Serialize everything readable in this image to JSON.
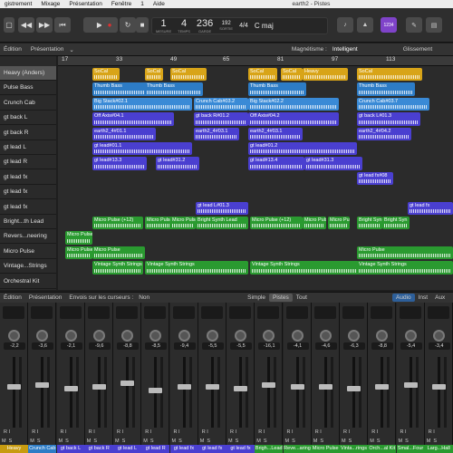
{
  "menubar": {
    "items": [
      "gistrement",
      "Mixage",
      "Présentation",
      "Fenêtre",
      "1",
      "Aide"
    ],
    "title": "earth2 - Pistes"
  },
  "transport": {
    "bar": "1",
    "beat": "4",
    "tempo": "236",
    "tempo_label": "TEMPO",
    "bar_label": "MESURE",
    "beat_label": "TEMPS",
    "keep_label": "GARDE",
    "cpu_value": "192",
    "cpu_label": "SORTIE",
    "signature": "4/4",
    "key": "C maj",
    "icon1": "tuner-icon",
    "icon2": "count-in-icon",
    "badge": "1234"
  },
  "toolbar": {
    "edit": "Édition",
    "presentation": "Présentation",
    "snap_label": "Magnétisme :",
    "snap_value": "Intelligent",
    "drag_label": "Glissement"
  },
  "ruler": {
    "ticks": [
      "17",
      "33",
      "49",
      "65",
      "81",
      "97",
      "113"
    ]
  },
  "tracks": [
    {
      "name": "Heavy (Anders)",
      "selected": true
    },
    {
      "name": "Pulse Bass"
    },
    {
      "name": "Crunch Cab"
    },
    {
      "name": "gt back L"
    },
    {
      "name": "gt back R"
    },
    {
      "name": "gt lead L"
    },
    {
      "name": "gt lead R"
    },
    {
      "name": "gt lead fx"
    },
    {
      "name": "gt lead fx"
    },
    {
      "name": "gt lead fx"
    },
    {
      "name": "Bright...th Lead"
    },
    {
      "name": "Revers...neering"
    },
    {
      "name": "Micro Pulse"
    },
    {
      "name": "Vintage...Strings"
    },
    {
      "name": "Orchestral Kit"
    }
  ],
  "regions": [
    {
      "label": "SoCal",
      "track": 0,
      "color": "#d8a418"
    },
    {
      "label": "SoCal",
      "track": 0,
      "color": "#d8a418"
    },
    {
      "label": "SoCal",
      "track": 0,
      "color": "#d8a418"
    },
    {
      "label": "SoCal",
      "track": 0,
      "color": "#d8a418"
    },
    {
      "label": "SoCal",
      "track": 0,
      "color": "#d8a418"
    },
    {
      "label": "Heavy",
      "track": 0,
      "color": "#d8a418"
    },
    {
      "label": "SoCal",
      "track": 0,
      "color": "#d8a418"
    },
    {
      "label": "Thumb Bass",
      "track": 1,
      "color": "#2d7cc6"
    },
    {
      "label": "Thumb Bass",
      "track": 1,
      "color": "#2d7cc6"
    },
    {
      "label": "Thumb Bass",
      "track": 1,
      "color": "#2d7cc6"
    },
    {
      "label": "Thumb Bass",
      "track": 1,
      "color": "#2d7cc6"
    },
    {
      "label": "Big Stack#02.1",
      "track": 2,
      "color": "#3a8ad6"
    },
    {
      "label": "Crunch Cab#03.2",
      "track": 2,
      "color": "#3a8ad6"
    },
    {
      "label": "Big Stack#02.2",
      "track": 2,
      "color": "#3a8ad6"
    },
    {
      "label": "Crunch Cab#03.7",
      "track": 2,
      "color": "#3a8ad6"
    },
    {
      "label": "Off Axis#04.1",
      "track": 3,
      "color": "#4a3fd0"
    },
    {
      "label": "gt back R#01.2",
      "track": 3,
      "color": "#4a3fd0"
    },
    {
      "label": "Off Axis#04.2",
      "track": 3,
      "color": "#4a3fd0"
    },
    {
      "label": "gt back L#01.3",
      "track": 3,
      "color": "#4a3fd0"
    },
    {
      "label": "earth2_4#01.1",
      "track": 4,
      "color": "#4a3fd0"
    },
    {
      "label": "earth2_4#03.1",
      "track": 4,
      "color": "#4a3fd0"
    },
    {
      "label": "earth2_4#03.1",
      "track": 4,
      "color": "#4a3fd0"
    },
    {
      "label": "earth2_4#04.2",
      "track": 4,
      "color": "#4a3fd0"
    },
    {
      "label": "gt lead#01.1",
      "track": 5,
      "color": "#4a3fd0"
    },
    {
      "label": "gt lead#01.2",
      "track": 5,
      "color": "#4a3fd0"
    },
    {
      "label": "gt lead#13.3",
      "track": 6,
      "color": "#4a3fd0"
    },
    {
      "label": "gt lead#31.2",
      "track": 6,
      "color": "#4a3fd0"
    },
    {
      "label": "gt lead#13.4",
      "track": 6,
      "color": "#4a3fd0"
    },
    {
      "label": "gt lead#31.3",
      "track": 6,
      "color": "#4a3fd0"
    },
    {
      "label": "gt lead fx#08",
      "track": 7,
      "color": "#4a3fd0"
    },
    {
      "label": "gt lead L#01.3",
      "track": 9,
      "color": "#4a3fd0"
    },
    {
      "label": "gt lead fx",
      "track": 9,
      "color": "#4a3fd0"
    },
    {
      "label": "Micro Pulse (+12)",
      "track": 10,
      "color": "#2a9a30"
    },
    {
      "label": "Micro Pulse",
      "track": 10,
      "color": "#2a9a30"
    },
    {
      "label": "Micro Pulse",
      "track": 10,
      "color": "#2a9a30"
    },
    {
      "label": "Bright Synth Lead",
      "track": 10,
      "color": "#2a9a30"
    },
    {
      "label": "Micro Pulse (+12)",
      "track": 10,
      "color": "#2a9a30"
    },
    {
      "label": "Micro Pulse",
      "track": 10,
      "color": "#2a9a30"
    },
    {
      "label": "Micro Pulse",
      "track": 10,
      "color": "#2a9a30"
    },
    {
      "label": "Bright Syn",
      "track": 10,
      "color": "#2a9a30"
    },
    {
      "label": "Bright Syn",
      "track": 10,
      "color": "#2a9a30"
    },
    {
      "label": "Micro Pulse",
      "track": 11,
      "color": "#2a9a30"
    },
    {
      "label": "Micro Pulse",
      "track": 12,
      "color": "#2a9a30"
    },
    {
      "label": "Micro Pulse",
      "track": 12,
      "color": "#2a9a30"
    },
    {
      "label": "Micro Pulse",
      "track": 12,
      "color": "#2a9a30"
    },
    {
      "label": "Vintage Synth Strings",
      "track": 13,
      "color": "#2a9a30"
    },
    {
      "label": "Vintage Synth Strings",
      "track": 13,
      "color": "#2a9a30"
    },
    {
      "label": "Vintage Synth Strings",
      "track": 13,
      "color": "#2a9a30"
    },
    {
      "label": "Vintage Synth Strings",
      "track": 13,
      "color": "#2a9a30"
    }
  ],
  "mixer_header": {
    "presentation": "Présentation",
    "sends_label": "Envois sur les curseurs :",
    "sends_value": "Non",
    "tabs": [
      "Simple",
      "Pistes",
      "Tout"
    ],
    "filters": [
      "Audio",
      "Inst",
      "Aux"
    ]
  },
  "channels": [
    {
      "name": "Heavy",
      "pan": "-2,2",
      "color": "#c79b10"
    },
    {
      "name": "Crunch Cab",
      "pan": "-3,6",
      "color": "#2d7cc6"
    },
    {
      "name": "gt back L",
      "pan": "-2,1",
      "color": "#4a3fd0"
    },
    {
      "name": "gt back R",
      "pan": "-9,6",
      "color": "#4a3fd0"
    },
    {
      "name": "gt lead L",
      "pan": "-8,8",
      "color": "#4a3fd0"
    },
    {
      "name": "gt lead R",
      "pan": "-8,5",
      "color": "#4a3fd0"
    },
    {
      "name": "gt lead fx",
      "pan": "-9,4",
      "color": "#4a3fd0"
    },
    {
      "name": "gt lead fx",
      "pan": "-5,5",
      "color": "#4a3fd0"
    },
    {
      "name": "gt lead fx",
      "pan": "-5,5",
      "color": "#4a3fd0"
    },
    {
      "name": "Brigh...Lead",
      "pan": "-16,1",
      "color": "#2a9a30"
    },
    {
      "name": "Reve...aring",
      "pan": "-4,1",
      "color": "#2a9a30"
    },
    {
      "name": "Micro Pulse",
      "pan": "-4,6",
      "color": "#2a9a30"
    },
    {
      "name": "Vinta...rings",
      "pan": "-6,3",
      "color": "#2a9a30"
    },
    {
      "name": "Orch...al Kit",
      "pan": "-8,8",
      "color": "#2a9a30"
    },
    {
      "name": "Smal...Four",
      "pan": "-5,4",
      "color": "#2a9a30"
    },
    {
      "name": "Larg...Hall",
      "pan": "-3,4",
      "color": "#2a9a30"
    }
  ],
  "strip_labels": {
    "r": "R",
    "i": "I",
    "m": "M",
    "s": "S"
  }
}
